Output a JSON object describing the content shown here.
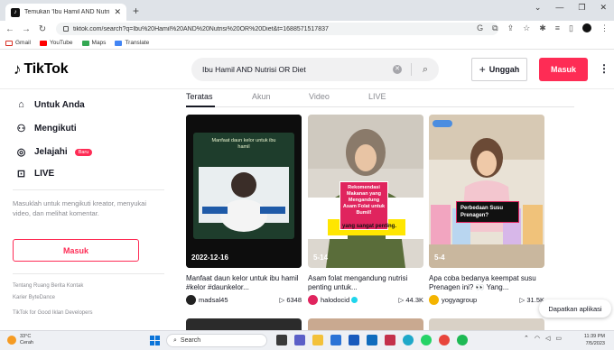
{
  "browser": {
    "tab_title": "Temukan 'Ibu Hamil AND Nutrisi ...",
    "url": "tiktok.com/search?q=Ibu%20Hamil%20AND%20Nutrisi%20OR%20Diet&t=1688571517837",
    "bookmarks": [
      {
        "label": "Gmail",
        "color": "#d93025"
      },
      {
        "label": "YouTube",
        "color": "#ff0000"
      },
      {
        "label": "Maps",
        "color": "#34a853"
      },
      {
        "label": "Translate",
        "color": "#4285f4"
      }
    ]
  },
  "header": {
    "logo": "TikTok",
    "search_value": "Ibu Hamil AND Nutrisi OR Diet",
    "upload_label": "Unggah",
    "login_label": "Masuk"
  },
  "sidebar": {
    "items": [
      {
        "label": "Untuk Anda",
        "icon": "home-icon"
      },
      {
        "label": "Mengikuti",
        "icon": "people-icon"
      },
      {
        "label": "Jelajahi",
        "icon": "compass-icon",
        "badge": "Baru"
      },
      {
        "label": "LIVE",
        "icon": "live-icon"
      }
    ],
    "login_prompt": "Masuklah untuk mengikuti kreator, menyukai video, dan melihat komentar.",
    "login_button": "Masuk",
    "footer_line1": "Tentang  Ruang Berita  Kontak",
    "footer_line2": "Karier  ByteDance",
    "footer_line3": "TikTok for Good  Iklan  Developers"
  },
  "tabs": [
    "Teratas",
    "Akun",
    "Video",
    "LIVE"
  ],
  "videos": [
    {
      "date_overlay": "2022-12-16",
      "overlay_text": "Manfaat daun kelor untuk ibu hamil",
      "title": "Manfaat daun kelor untuk ibu hamil #kelor #daunkelor...",
      "author": "madsal45",
      "verified": false,
      "plays": "6348",
      "avatar_color": "#222222"
    },
    {
      "date_overlay": "5-14",
      "overlay_text": "Rekomendasi Makanan yang Mengandung Asam Folat untuk Bumil!",
      "overlay_caption": "yang sangat penting.",
      "title": "Asam folat mengandung nutrisi penting untuk...",
      "author": "halodocid",
      "verified": true,
      "plays": "44.3K",
      "avatar_color": "#e0245e"
    },
    {
      "date_overlay": "5-4",
      "overlay_text": "Perbedaan Susu Prenagen?",
      "title": "Apa coba bedanya keempat susu Prenagen ini? 👀 Yang...",
      "author": "yogyagroup",
      "verified": false,
      "plays": "31.5K",
      "avatar_color": "#f4b400"
    }
  ],
  "get_app": "Dapatkan aplikasi",
  "taskbar": {
    "weather_temp": "33°C",
    "weather_desc": "Cerah",
    "search_label": "Search",
    "time": "11:39 PM",
    "date": "7/5/2023"
  },
  "colors": {
    "accent": "#fe2c55",
    "text": "#161823",
    "muted": "#8a8b91"
  }
}
